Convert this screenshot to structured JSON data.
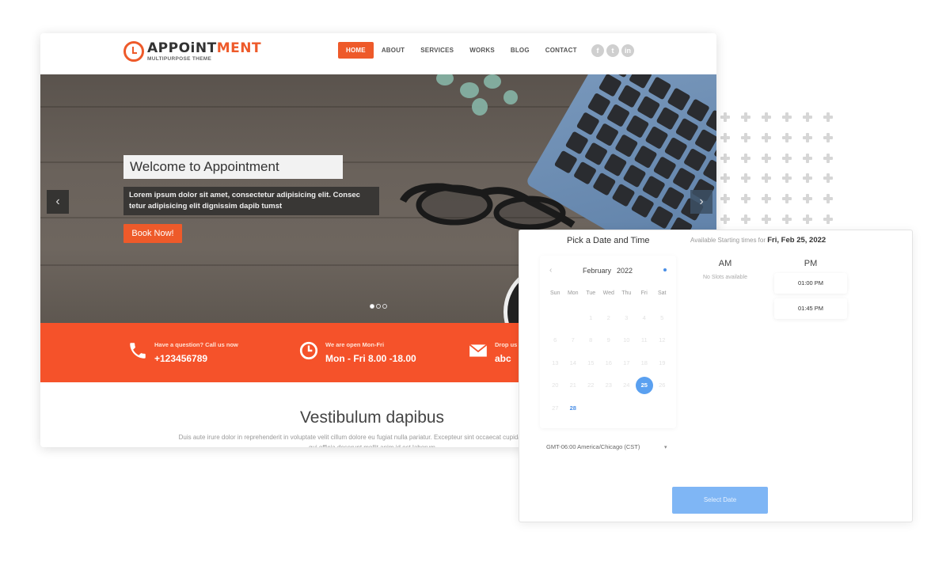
{
  "website": {
    "logo": {
      "main_dark": "APPOiNT",
      "main_accent": "MENT",
      "subtitle": "MULTIPURPOSE THEME"
    },
    "nav": [
      {
        "label": "HOME",
        "active": true
      },
      {
        "label": "ABOUT",
        "active": false
      },
      {
        "label": "SERVICES",
        "active": false
      },
      {
        "label": "WORKS",
        "active": false
      },
      {
        "label": "BLOG",
        "active": false
      },
      {
        "label": "CONTACT",
        "active": false
      }
    ],
    "socials": [
      {
        "icon": "facebook-icon",
        "glyph": "f"
      },
      {
        "icon": "twitter-icon",
        "glyph": "t"
      },
      {
        "icon": "linkedin-icon",
        "glyph": "in"
      }
    ],
    "hero": {
      "title": "Welcome to Appointment",
      "description": "Lorem ipsum dolor sit amet, consectetur adipisicing elit. Consec tetur adipisicing elit dignissim dapib tumst",
      "button": "Book Now!",
      "prev_glyph": "‹",
      "next_glyph": "›",
      "slides": 3,
      "active_slide": 1
    },
    "infobar": [
      {
        "icon": "phone-icon",
        "label": "Have a question? Call us now",
        "value": "+123456789"
      },
      {
        "icon": "clock-icon",
        "label": "We are open Mon-Fri",
        "value": "Mon - Fri 8.00 -18.00"
      },
      {
        "icon": "mail-icon",
        "label": "Drop us a line",
        "value": "abc"
      }
    ],
    "section": {
      "title": "Vestibulum dapibus",
      "text": "Duis aute irure dolor in reprehenderit in voluptate velit cillum dolore eu fugiat nulla pariatur. Excepteur sint occaecat cupidatat non proident",
      "text2": "qui officia deserunt mollit anim id est laborum"
    },
    "colors": {
      "accent": "#ee5a2a",
      "infobar": "#f5522a"
    }
  },
  "scheduler": {
    "title": "Pick a Date and Time",
    "available_prefix": "Available Starting times for",
    "available_date": "Fri, Feb 25, 2022",
    "calendar": {
      "prev_glyph": "‹",
      "month": "February",
      "year": "2022",
      "weekdays": [
        "Sun",
        "Mon",
        "Tue",
        "Wed",
        "Thu",
        "Fri",
        "Sat"
      ],
      "weeks": [
        [
          "",
          "",
          "1",
          "2",
          "3",
          "4",
          "5"
        ],
        [
          "6",
          "7",
          "8",
          "9",
          "10",
          "11",
          "12"
        ],
        [
          "13",
          "14",
          "15",
          "16",
          "17",
          "18",
          "19"
        ],
        [
          "20",
          "21",
          "22",
          "23",
          "24",
          "25",
          "26"
        ],
        [
          "27",
          "28",
          "",
          "",
          "",
          "",
          ""
        ]
      ],
      "selected": "25",
      "available": [
        "25",
        "28"
      ]
    },
    "am": {
      "title": "AM",
      "empty": "No Slots available"
    },
    "pm": {
      "title": "PM",
      "slots": [
        "01:00 PM",
        "01:45 PM"
      ]
    },
    "timezone": "GMT-06:00 America/Chicago (CST)",
    "timezone_caret": "▾",
    "select_button": "Select Date",
    "colors": {
      "primary": "#5aa0f0",
      "button": "#7fb6f5"
    }
  }
}
